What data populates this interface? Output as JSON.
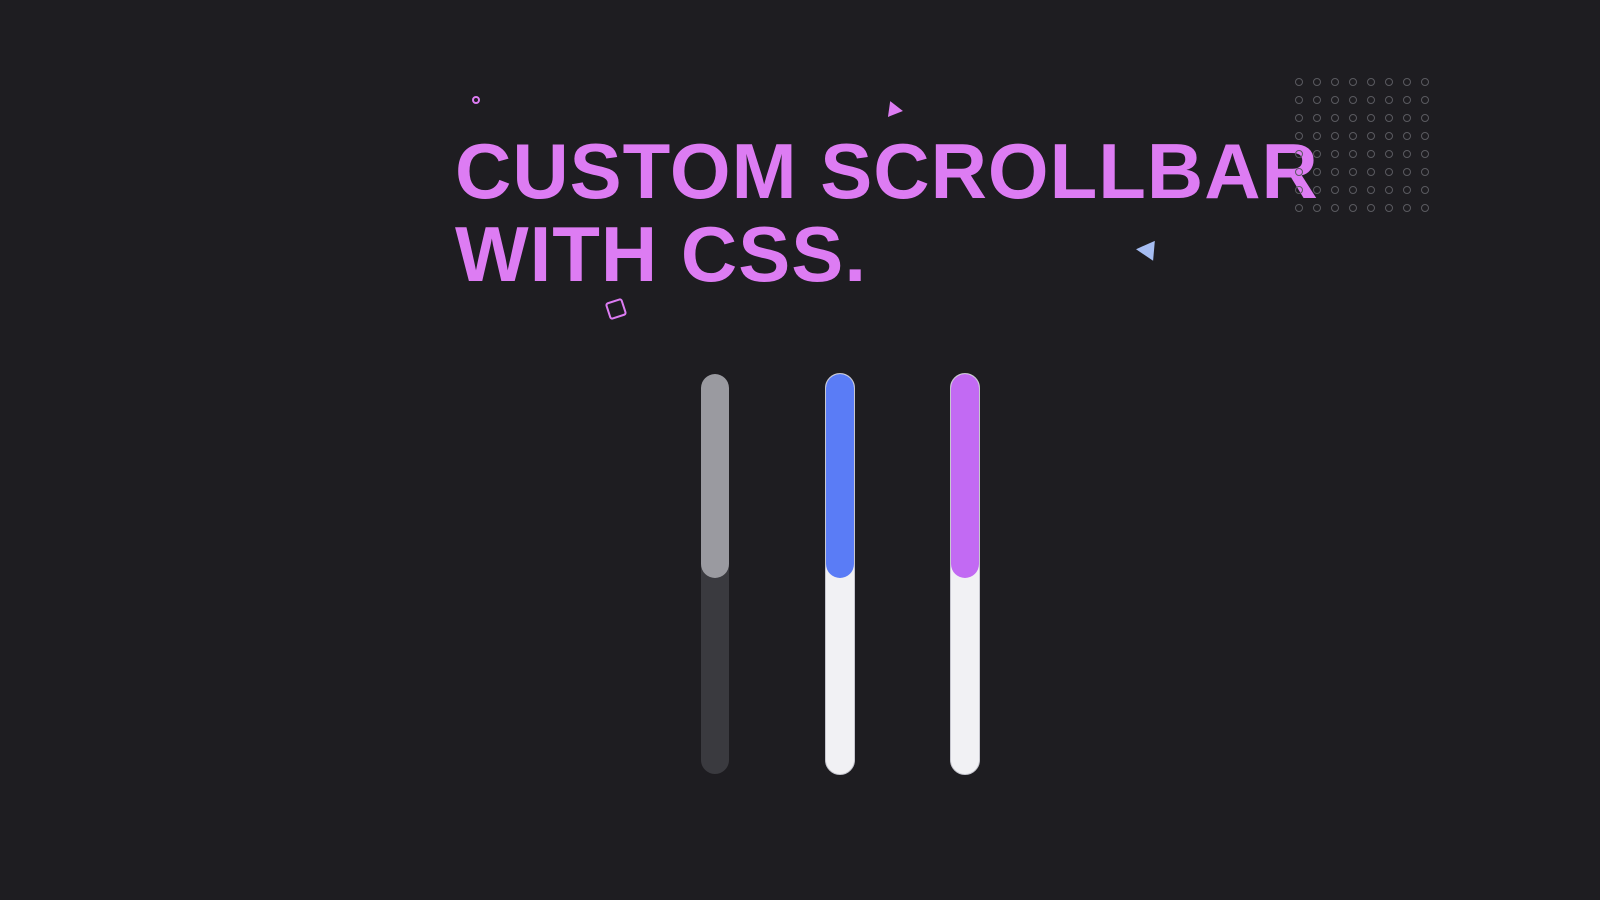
{
  "title": "CUSTOM SCROLLBAR\nWITH CSS.",
  "colors": {
    "bg": "#1e1d21",
    "accent_pink": "#dd7cf3",
    "accent_blue": "#a6bdf2",
    "thumb_grey": "#9a9aa0",
    "thumb_blue": "#5a7cf6",
    "thumb_purple": "#c26af3",
    "track_dark": "#3a3a3f",
    "track_light": "#f1f1f4"
  },
  "dotgrid": {
    "rows": 8,
    "cols": 8
  },
  "scrollbars": [
    {
      "track": "dark",
      "thumb": "grey",
      "thumb_pct": 51
    },
    {
      "track": "light",
      "thumb": "blue",
      "thumb_pct": 51
    },
    {
      "track": "light",
      "thumb": "purple",
      "thumb_pct": 51
    }
  ]
}
